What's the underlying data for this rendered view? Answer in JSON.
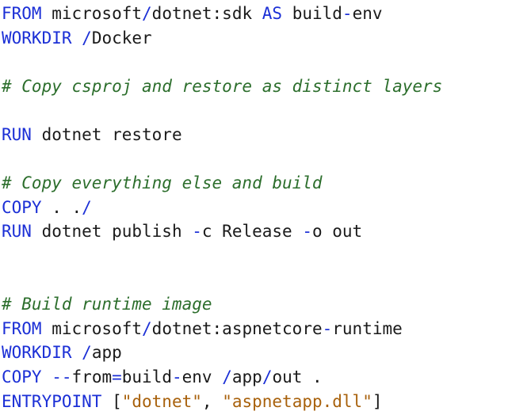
{
  "lines": [
    [
      {
        "t": "kw",
        "v": "FROM"
      },
      {
        "t": "tx",
        "v": " microsoft"
      },
      {
        "t": "op",
        "v": "/"
      },
      {
        "t": "tx",
        "v": "dotnet:sdk "
      },
      {
        "t": "kw",
        "v": "AS"
      },
      {
        "t": "tx",
        "v": " build"
      },
      {
        "t": "op",
        "v": "-"
      },
      {
        "t": "tx",
        "v": "env"
      }
    ],
    [
      {
        "t": "kw",
        "v": "WORKDIR"
      },
      {
        "t": "tx",
        "v": " "
      },
      {
        "t": "op",
        "v": "/"
      },
      {
        "t": "tx",
        "v": "Docker"
      }
    ],
    [],
    [
      {
        "t": "cm",
        "v": "# Copy csproj and restore as distinct layers"
      }
    ],
    [],
    [
      {
        "t": "kw",
        "v": "RUN"
      },
      {
        "t": "tx",
        "v": " dotnet restore"
      }
    ],
    [],
    [
      {
        "t": "cm",
        "v": "# Copy everything else and build"
      }
    ],
    [
      {
        "t": "kw",
        "v": "COPY"
      },
      {
        "t": "tx",
        "v": " . ."
      },
      {
        "t": "op",
        "v": "/"
      }
    ],
    [
      {
        "t": "kw",
        "v": "RUN"
      },
      {
        "t": "tx",
        "v": " dotnet publish "
      },
      {
        "t": "op",
        "v": "-"
      },
      {
        "t": "tx",
        "v": "c Release "
      },
      {
        "t": "op",
        "v": "-"
      },
      {
        "t": "tx",
        "v": "o out"
      }
    ],
    [],
    [],
    [
      {
        "t": "cm",
        "v": "# Build runtime image"
      }
    ],
    [
      {
        "t": "kw",
        "v": "FROM"
      },
      {
        "t": "tx",
        "v": " microsoft"
      },
      {
        "t": "op",
        "v": "/"
      },
      {
        "t": "tx",
        "v": "dotnet:aspnetcore"
      },
      {
        "t": "op",
        "v": "-"
      },
      {
        "t": "tx",
        "v": "runtime"
      }
    ],
    [
      {
        "t": "kw",
        "v": "WORKDIR"
      },
      {
        "t": "tx",
        "v": " "
      },
      {
        "t": "op",
        "v": "/"
      },
      {
        "t": "tx",
        "v": "app"
      }
    ],
    [
      {
        "t": "kw",
        "v": "COPY"
      },
      {
        "t": "tx",
        "v": " "
      },
      {
        "t": "op",
        "v": "--"
      },
      {
        "t": "tx",
        "v": "from"
      },
      {
        "t": "op",
        "v": "="
      },
      {
        "t": "tx",
        "v": "build"
      },
      {
        "t": "op",
        "v": "-"
      },
      {
        "t": "tx",
        "v": "env "
      },
      {
        "t": "op",
        "v": "/"
      },
      {
        "t": "tx",
        "v": "app"
      },
      {
        "t": "op",
        "v": "/"
      },
      {
        "t": "tx",
        "v": "out ."
      }
    ],
    [
      {
        "t": "kw",
        "v": "ENTRYPOINT"
      },
      {
        "t": "tx",
        "v": " ["
      },
      {
        "t": "str",
        "v": "\"dotnet\""
      },
      {
        "t": "tx",
        "v": ", "
      },
      {
        "t": "str",
        "v": "\"aspnetapp.dll\""
      },
      {
        "t": "tx",
        "v": "]"
      }
    ]
  ]
}
